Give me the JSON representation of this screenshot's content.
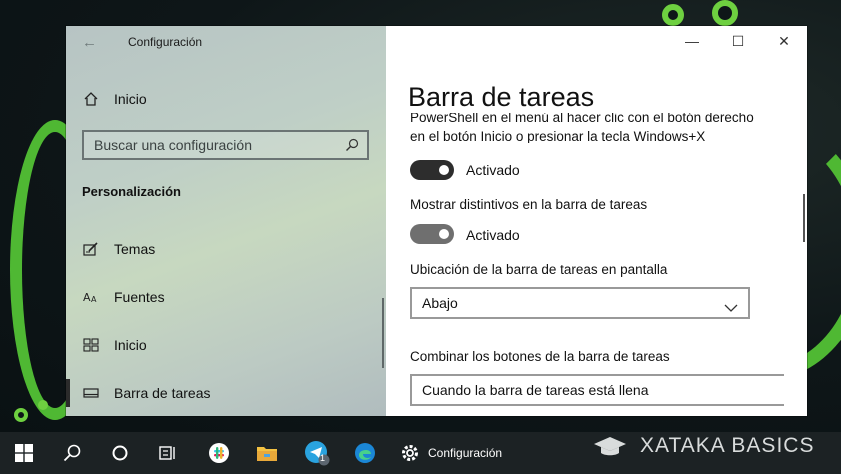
{
  "window": {
    "app_title": "Configuración",
    "controls": {
      "minimize": "—",
      "maximize": "☐",
      "close": "✕"
    }
  },
  "sidebar": {
    "back_icon": "back-arrow-icon",
    "home_label": "Inicio",
    "search_placeholder": "Buscar una configuración",
    "section_title": "Personalización",
    "items": [
      {
        "label": "Temas",
        "icon": "themes-icon"
      },
      {
        "label": "Fuentes",
        "icon": "fonts-icon"
      },
      {
        "label": "Inicio",
        "icon": "start-icon"
      },
      {
        "label": "Barra de tareas",
        "icon": "taskbar-icon",
        "selected": true
      }
    ]
  },
  "content": {
    "page_title": "Barra de tareas",
    "clipped_line_1": "PowerShell en el menú al hacer clic con el botón derecho",
    "clipped_line_2": "en el botón Inicio o presionar la tecla Windows+X",
    "toggle1": {
      "state_label": "Activado",
      "on": true
    },
    "badges_label": "Mostrar distintivos en la barra de tareas",
    "toggle2": {
      "state_label": "Activado",
      "on": true
    },
    "location_label": "Ubicación de la barra de tareas en pantalla",
    "location_value": "Abajo",
    "combine_label": "Combinar los botones de la barra de tareas",
    "combine_value": "Cuando la barra de tareas está llena"
  },
  "taskbar": {
    "active_app_label": "Configuración",
    "telegram_badge": "1",
    "brand_text": "XATAKA BASICS"
  },
  "colors": {
    "accent_green": "#4fb833",
    "toggle_on": "#2d2d2d",
    "taskbar_bg": "#1c2224"
  }
}
